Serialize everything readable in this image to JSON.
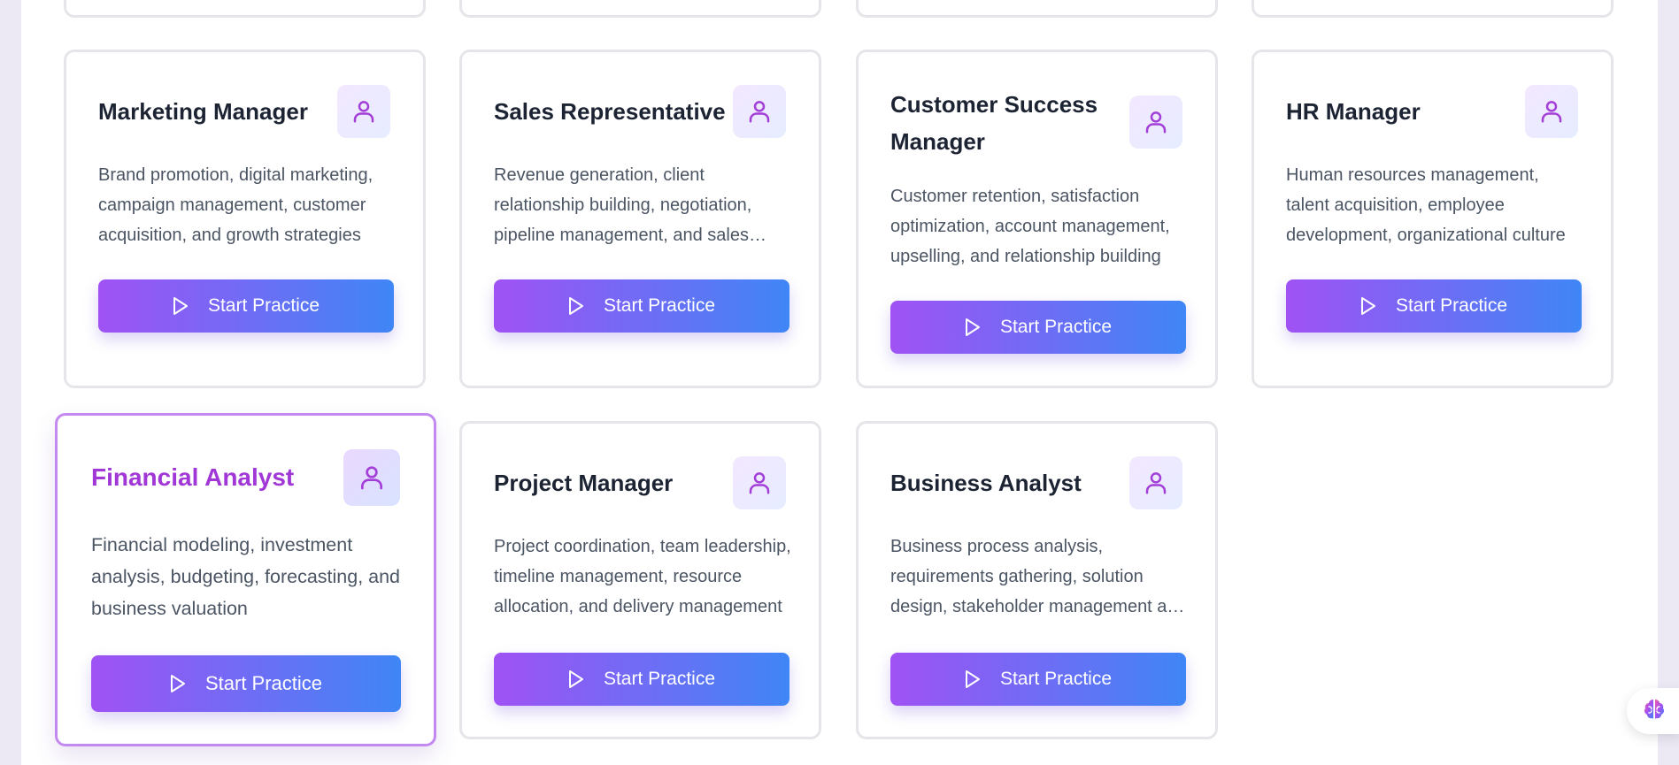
{
  "cards": [
    {
      "title": "Marketing Manager",
      "description": "Brand promotion, digital marketing, campaign management, customer acquisition, and growth strategies",
      "button_label": "Start Practice"
    },
    {
      "title": "Sales Representative",
      "description": "Revenue generation, client relationship building, negotiation, pipeline management, and sales strategy",
      "button_label": "Start Practice"
    },
    {
      "title": "Customer Success Manager",
      "description": "Customer retention, satisfaction optimization, account management, upselling, and relationship building",
      "button_label": "Start Practice"
    },
    {
      "title": "HR Manager",
      "description": "Human resources management, talent acquisition, employee development, organizational culture",
      "button_label": "Start Practice"
    },
    {
      "title": "Financial Analyst",
      "description": "Financial modeling, investment analysis, budgeting, forecasting, and business valuation",
      "button_label": "Start Practice"
    },
    {
      "title": "Project Manager",
      "description": "Project coordination, team leadership, timeline management, resource allocation, and delivery management",
      "button_label": "Start Practice"
    },
    {
      "title": "Business Analyst",
      "description": "Business process analysis, requirements gathering, solution design, stakeholder management and documentation",
      "button_label": "Start Practice"
    }
  ],
  "icons": {
    "card_icon": "user-icon",
    "button_icon": "play-icon",
    "assistant": "brain-icon"
  },
  "colors": {
    "accent_purple": "#a052f4",
    "accent_blue": "#3f86f6",
    "active_title": "#a037d6",
    "icon_purple": "#a33ed8"
  }
}
